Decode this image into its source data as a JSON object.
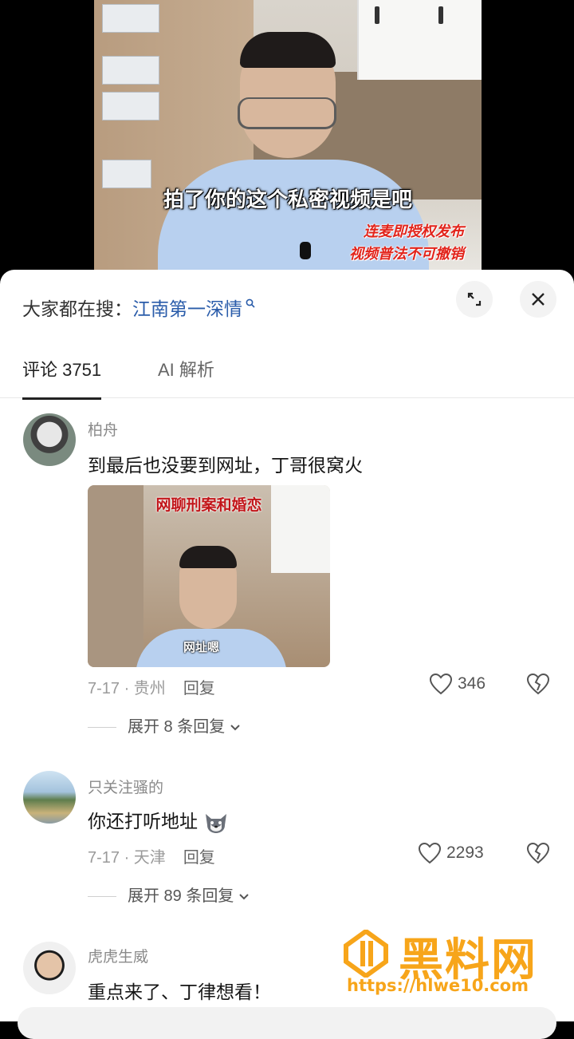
{
  "video": {
    "subtitle": "拍了你的这个私密视频是吧",
    "tag_line1": "连麦即授权发布",
    "tag_line2": "视频普法不可撤销"
  },
  "search": {
    "prefix": "大家都在搜：",
    "keyword": "江南第一深情"
  },
  "tabs": [
    {
      "label": "评论 3751",
      "active": true
    },
    {
      "label": "AI 解析",
      "active": false
    }
  ],
  "comments": [
    {
      "user": "柏舟",
      "text": "到最后也没要到网址，丁哥很窝火",
      "image_title": "网聊刑案和婚恋",
      "image_caption": "网址嗯",
      "date_location": "7-17 · 贵州",
      "reply_label": "回复",
      "likes": "346",
      "expand_label": "展开 8 条回复"
    },
    {
      "user": "只关注骚的",
      "text": "你还打听地址",
      "date_location": "7-17 · 天津",
      "reply_label": "回复",
      "likes": "2293",
      "expand_label": "展开 89 条回复"
    },
    {
      "user": "虎虎生威",
      "text": "重点来了、丁律想看！"
    }
  ],
  "watermark": {
    "title": "黑料网",
    "url": "https://hlwe10.com"
  },
  "icons": {
    "expand": "collapse-icon",
    "close": "close-icon",
    "like": "heart-icon",
    "dislike": "broken-heart-icon",
    "chevron": "chevron-down-icon"
  },
  "colors": {
    "keyword_blue": "#2a5caa",
    "watermark_orange": "#f7a51a",
    "subtitle_red": "#e2241b"
  }
}
